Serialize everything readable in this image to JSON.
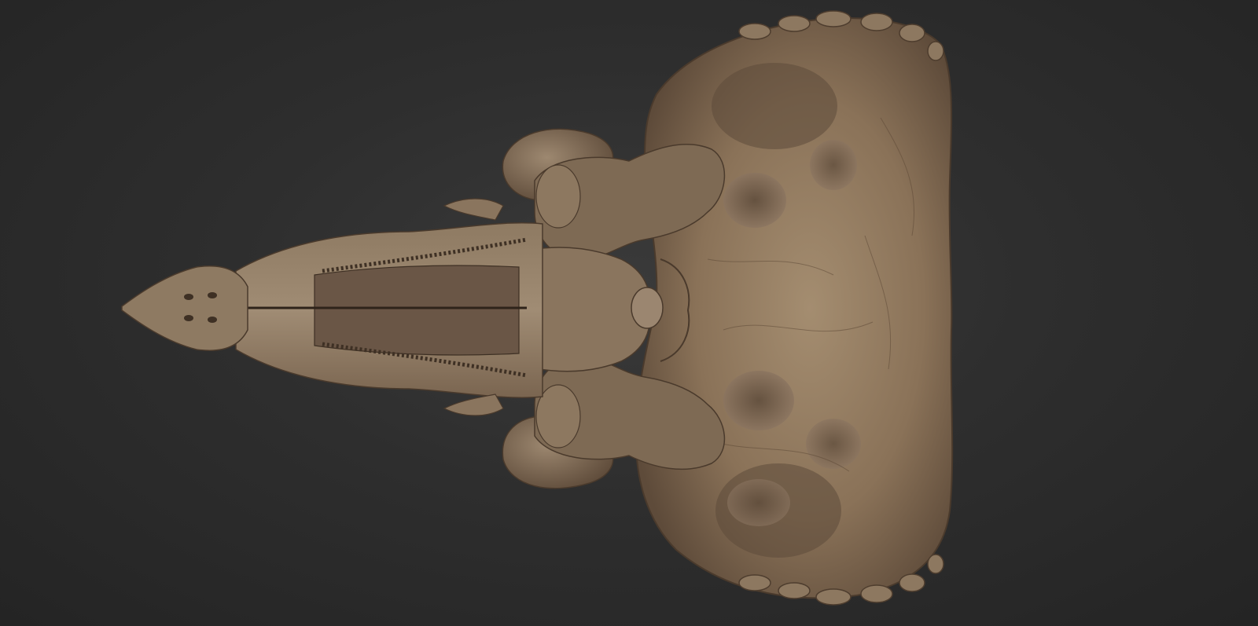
{
  "scene": {
    "subject": "triceratops-skull-3d-model",
    "background_color": "#2c2c2c",
    "bone_color_light": "#a89274",
    "bone_color_mid": "#7c6650",
    "bone_color_dark": "#4a3a2c"
  }
}
